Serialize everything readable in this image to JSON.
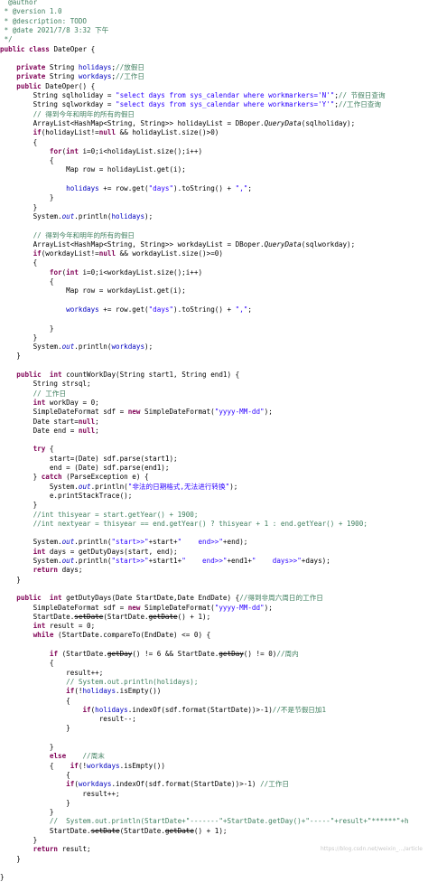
{
  "lines": [
    [
      {
        "t": "  @author",
        "c": "cm"
      }
    ],
    [
      {
        "t": " * @version 1.0",
        "c": "cm"
      }
    ],
    [
      {
        "t": " * @description: TODO",
        "c": "cm"
      }
    ],
    [
      {
        "t": " * @date 2021/7/8 3:32 下午",
        "c": "cm"
      }
    ],
    [
      {
        "t": " */",
        "c": "cm"
      }
    ],
    [
      {
        "t": "public class",
        "c": "kw"
      },
      {
        "t": " DateOper {"
      }
    ],
    [
      {
        "t": ""
      }
    ],
    [
      {
        "t": "    "
      },
      {
        "t": "private",
        "c": "kw"
      },
      {
        "t": " String "
      },
      {
        "t": "holidays",
        "c": "field"
      },
      {
        "t": ";"
      },
      {
        "t": "//放假日",
        "c": "cm"
      }
    ],
    [
      {
        "t": "    "
      },
      {
        "t": "private",
        "c": "kw"
      },
      {
        "t": " String "
      },
      {
        "t": "workdays",
        "c": "field"
      },
      {
        "t": ";"
      },
      {
        "t": "//工作日",
        "c": "cm"
      }
    ],
    [
      {
        "t": "    "
      },
      {
        "t": "public",
        "c": "kw"
      },
      {
        "t": " DateOper() {"
      }
    ],
    [
      {
        "t": "        String sqlholiday = "
      },
      {
        "t": "\"select days from sys_calendar where workmarkers='N'\"",
        "c": "str"
      },
      {
        "t": ";"
      },
      {
        "t": "// 节假日查询",
        "c": "cm"
      }
    ],
    [
      {
        "t": "        String sqlworkday = "
      },
      {
        "t": "\"select days from sys_calendar where workmarkers='Y'\"",
        "c": "str"
      },
      {
        "t": ";"
      },
      {
        "t": "//工作日查询",
        "c": "cm"
      }
    ],
    [
      {
        "t": "        "
      },
      {
        "t": "// 得到今年和明年的所有的假日",
        "c": "cm"
      }
    ],
    [
      {
        "t": "        ArrayList<HashMap<String, String>> holidayList = DBoper."
      },
      {
        "t": "QueryData",
        "c": "ital"
      },
      {
        "t": "(sqlholiday);"
      }
    ],
    [
      {
        "t": "        "
      },
      {
        "t": "if",
        "c": "kw"
      },
      {
        "t": "(holidayList!="
      },
      {
        "t": "null",
        "c": "kw"
      },
      {
        "t": " && holidayList.size()>0)"
      }
    ],
    [
      {
        "t": "        {"
      }
    ],
    [
      {
        "t": "            "
      },
      {
        "t": "for",
        "c": "kw"
      },
      {
        "t": "("
      },
      {
        "t": "int",
        "c": "kw"
      },
      {
        "t": " i=0;i<holidayList.size();i++)"
      }
    ],
    [
      {
        "t": "            {"
      }
    ],
    [
      {
        "t": "                Map row = holidayList.get(i);"
      }
    ],
    [
      {
        "t": ""
      }
    ],
    [
      {
        "t": "                "
      },
      {
        "t": "holidays",
        "c": "field"
      },
      {
        "t": " += row.get("
      },
      {
        "t": "\"days\"",
        "c": "str"
      },
      {
        "t": ").toString() + "
      },
      {
        "t": "\",\"",
        "c": "str"
      },
      {
        "t": ";"
      }
    ],
    [
      {
        "t": "            }"
      }
    ],
    [
      {
        "t": "        }"
      }
    ],
    [
      {
        "t": "        System."
      },
      {
        "t": "out",
        "c": "stat"
      },
      {
        "t": ".println("
      },
      {
        "t": "holidays",
        "c": "field"
      },
      {
        "t": ");"
      }
    ],
    [
      {
        "t": ""
      }
    ],
    [
      {
        "t": "        "
      },
      {
        "t": "// 得到今年和明年的所有的假日",
        "c": "cm"
      }
    ],
    [
      {
        "t": "        ArrayList<HashMap<String, String>> workdayList = DBoper."
      },
      {
        "t": "QueryData",
        "c": "ital"
      },
      {
        "t": "(sqlworkday);"
      }
    ],
    [
      {
        "t": "        "
      },
      {
        "t": "if",
        "c": "kw"
      },
      {
        "t": "(workdayList!="
      },
      {
        "t": "null",
        "c": "kw"
      },
      {
        "t": " && workdayList.size()>=0)"
      }
    ],
    [
      {
        "t": "        {"
      }
    ],
    [
      {
        "t": "            "
      },
      {
        "t": "for",
        "c": "kw"
      },
      {
        "t": "("
      },
      {
        "t": "int",
        "c": "kw"
      },
      {
        "t": " i=0;i<workdayList.size();i++)"
      }
    ],
    [
      {
        "t": "            {"
      }
    ],
    [
      {
        "t": "                Map row = workdayList.get(i);"
      }
    ],
    [
      {
        "t": ""
      }
    ],
    [
      {
        "t": "                "
      },
      {
        "t": "workdays",
        "c": "field"
      },
      {
        "t": " += row.get("
      },
      {
        "t": "\"days\"",
        "c": "str"
      },
      {
        "t": ").toString() + "
      },
      {
        "t": "\",\"",
        "c": "str"
      },
      {
        "t": ";"
      }
    ],
    [
      {
        "t": ""
      }
    ],
    [
      {
        "t": "            }"
      }
    ],
    [
      {
        "t": "        }"
      }
    ],
    [
      {
        "t": "        System."
      },
      {
        "t": "out",
        "c": "stat"
      },
      {
        "t": ".println("
      },
      {
        "t": "workdays",
        "c": "field"
      },
      {
        "t": ");"
      }
    ],
    [
      {
        "t": "    }"
      }
    ],
    [
      {
        "t": ""
      }
    ],
    [
      {
        "t": "    "
      },
      {
        "t": "public",
        "c": "kw"
      },
      {
        "t": "  "
      },
      {
        "t": "int",
        "c": "kw"
      },
      {
        "t": " countWorkDay(String start1, String end1) {"
      }
    ],
    [
      {
        "t": "        String strsql;"
      }
    ],
    [
      {
        "t": "        "
      },
      {
        "t": "// 工作日",
        "c": "cm"
      }
    ],
    [
      {
        "t": "        "
      },
      {
        "t": "int",
        "c": "kw"
      },
      {
        "t": " workDay = 0;"
      }
    ],
    [
      {
        "t": "        SimpleDateFormat sdf = "
      },
      {
        "t": "new",
        "c": "kw"
      },
      {
        "t": " SimpleDateFormat("
      },
      {
        "t": "\"yyyy-MM-dd\"",
        "c": "str"
      },
      {
        "t": ");"
      }
    ],
    [
      {
        "t": "        Date start="
      },
      {
        "t": "null",
        "c": "kw"
      },
      {
        "t": ";"
      }
    ],
    [
      {
        "t": "        Date end = "
      },
      {
        "t": "null",
        "c": "kw"
      },
      {
        "t": ";"
      }
    ],
    [
      {
        "t": ""
      }
    ],
    [
      {
        "t": "        "
      },
      {
        "t": "try",
        "c": "kw"
      },
      {
        "t": " {"
      }
    ],
    [
      {
        "t": "            start=(Date) sdf.parse(start1);"
      }
    ],
    [
      {
        "t": "            end = (Date) sdf.parse(end1);"
      }
    ],
    [
      {
        "t": "        } "
      },
      {
        "t": "catch",
        "c": "kw"
      },
      {
        "t": " (ParseException e) {"
      }
    ],
    [
      {
        "t": "            System."
      },
      {
        "t": "out",
        "c": "stat"
      },
      {
        "t": ".println("
      },
      {
        "t": "\"非法的日期格式,无法进行转换\"",
        "c": "str"
      },
      {
        "t": ");"
      }
    ],
    [
      {
        "t": "            e.printStackTrace();"
      }
    ],
    [
      {
        "t": "        }"
      }
    ],
    [
      {
        "t": "        "
      },
      {
        "t": "//int thisyear = start.getYear() + 1900;",
        "c": "cm"
      }
    ],
    [
      {
        "t": "        "
      },
      {
        "t": "//int nextyear = thisyear == end.getYear() ? thisyear + 1 : end.getYear() + 1900;",
        "c": "cm"
      }
    ],
    [
      {
        "t": ""
      }
    ],
    [
      {
        "t": "        System."
      },
      {
        "t": "out",
        "c": "stat"
      },
      {
        "t": ".println("
      },
      {
        "t": "\"start>>\"",
        "c": "str"
      },
      {
        "t": "+start+"
      },
      {
        "t": "\"    end>>\"",
        "c": "str"
      },
      {
        "t": "+end);"
      }
    ],
    [
      {
        "t": "        "
      },
      {
        "t": "int",
        "c": "kw"
      },
      {
        "t": " days = getDutyDays(start, end);"
      }
    ],
    [
      {
        "t": "        System."
      },
      {
        "t": "out",
        "c": "stat"
      },
      {
        "t": ".println("
      },
      {
        "t": "\"start>>\"",
        "c": "str"
      },
      {
        "t": "+start1+"
      },
      {
        "t": "\"    end>>\"",
        "c": "str"
      },
      {
        "t": "+end1+"
      },
      {
        "t": "\"    days>>\"",
        "c": "str"
      },
      {
        "t": "+days);"
      }
    ],
    [
      {
        "t": "        "
      },
      {
        "t": "return",
        "c": "kw"
      },
      {
        "t": " days;"
      }
    ],
    [
      {
        "t": "    }"
      }
    ],
    [
      {
        "t": ""
      }
    ],
    [
      {
        "t": "    "
      },
      {
        "t": "public",
        "c": "kw"
      },
      {
        "t": "  "
      },
      {
        "t": "int",
        "c": "kw"
      },
      {
        "t": " getDutyDays(Date StartDate,Date EndDate) {"
      },
      {
        "t": "//得到非周六周日的工作日",
        "c": "cm"
      }
    ],
    [
      {
        "t": "        SimpleDateFormat sdf = "
      },
      {
        "t": "new",
        "c": "kw"
      },
      {
        "t": " SimpleDateFormat("
      },
      {
        "t": "\"yyyy-MM-dd\"",
        "c": "str"
      },
      {
        "t": ");"
      }
    ],
    [
      {
        "t": "        StartDate."
      },
      {
        "t": "setDate",
        "c": "strike"
      },
      {
        "t": "(StartDate."
      },
      {
        "t": "getDate",
        "c": "strike"
      },
      {
        "t": "() + 1);"
      }
    ],
    [
      {
        "t": "        "
      },
      {
        "t": "int",
        "c": "kw"
      },
      {
        "t": " result = 0;"
      }
    ],
    [
      {
        "t": "        "
      },
      {
        "t": "while",
        "c": "kw"
      },
      {
        "t": " (StartDate.compareTo(EndDate) <= 0) {"
      }
    ],
    [
      {
        "t": ""
      }
    ],
    [
      {
        "t": "            "
      },
      {
        "t": "if",
        "c": "kw"
      },
      {
        "t": " (StartDate."
      },
      {
        "t": "getDay",
        "c": "strike"
      },
      {
        "t": "() != 6 && StartDate."
      },
      {
        "t": "getDay",
        "c": "strike"
      },
      {
        "t": "() != 0)"
      },
      {
        "t": "//周内",
        "c": "cm"
      }
    ],
    [
      {
        "t": "            {"
      }
    ],
    [
      {
        "t": "                result++;"
      }
    ],
    [
      {
        "t": "                "
      },
      {
        "t": "// System.out.println(holidays);",
        "c": "cm"
      }
    ],
    [
      {
        "t": "                "
      },
      {
        "t": "if",
        "c": "kw"
      },
      {
        "t": "(!"
      },
      {
        "t": "holidays",
        "c": "field"
      },
      {
        "t": ".isEmpty())"
      }
    ],
    [
      {
        "t": "                {"
      }
    ],
    [
      {
        "t": "                    "
      },
      {
        "t": "if",
        "c": "kw"
      },
      {
        "t": "("
      },
      {
        "t": "holidays",
        "c": "field"
      },
      {
        "t": ".indexOf(sdf.format(StartDate))>-1)"
      },
      {
        "t": "//不是节假日加1",
        "c": "cm"
      }
    ],
    [
      {
        "t": "                        result--;"
      }
    ],
    [
      {
        "t": "                }"
      }
    ],
    [
      {
        "t": ""
      }
    ],
    [
      {
        "t": "            }"
      }
    ],
    [
      {
        "t": "            "
      },
      {
        "t": "else",
        "c": "kw"
      },
      {
        "t": "    "
      },
      {
        "t": "//周末",
        "c": "cm"
      }
    ],
    [
      {
        "t": "            {    "
      },
      {
        "t": "if",
        "c": "kw"
      },
      {
        "t": "(!"
      },
      {
        "t": "workdays",
        "c": "field"
      },
      {
        "t": ".isEmpty())"
      }
    ],
    [
      {
        "t": "                {"
      }
    ],
    [
      {
        "t": "                "
      },
      {
        "t": "if",
        "c": "kw"
      },
      {
        "t": "("
      },
      {
        "t": "workdays",
        "c": "field"
      },
      {
        "t": ".indexOf(sdf.format(StartDate))>-1) "
      },
      {
        "t": "//工作日",
        "c": "cm"
      }
    ],
    [
      {
        "t": "                    result++;"
      }
    ],
    [
      {
        "t": "                }"
      }
    ],
    [
      {
        "t": "            }"
      }
    ],
    [
      {
        "t": "            "
      },
      {
        "t": "//  System.out.println(StartDate+\"-------\"+StartDate.getDay()+\"-----\"+result+\"******\"+h",
        "c": "cm"
      }
    ],
    [
      {
        "t": "            StartDate."
      },
      {
        "t": "setDate",
        "c": "strike"
      },
      {
        "t": "(StartDate."
      },
      {
        "t": "getDate",
        "c": "strike"
      },
      {
        "t": "() + 1);"
      }
    ],
    [
      {
        "t": "        }"
      }
    ],
    [
      {
        "t": "        "
      },
      {
        "t": "return",
        "c": "kw"
      },
      {
        "t": " result;"
      }
    ],
    [
      {
        "t": "    }"
      }
    ],
    [
      {
        "t": ""
      }
    ],
    [
      {
        "t": "}"
      }
    ]
  ],
  "watermark": "https://blog.csdn.net/weixin_.../article"
}
